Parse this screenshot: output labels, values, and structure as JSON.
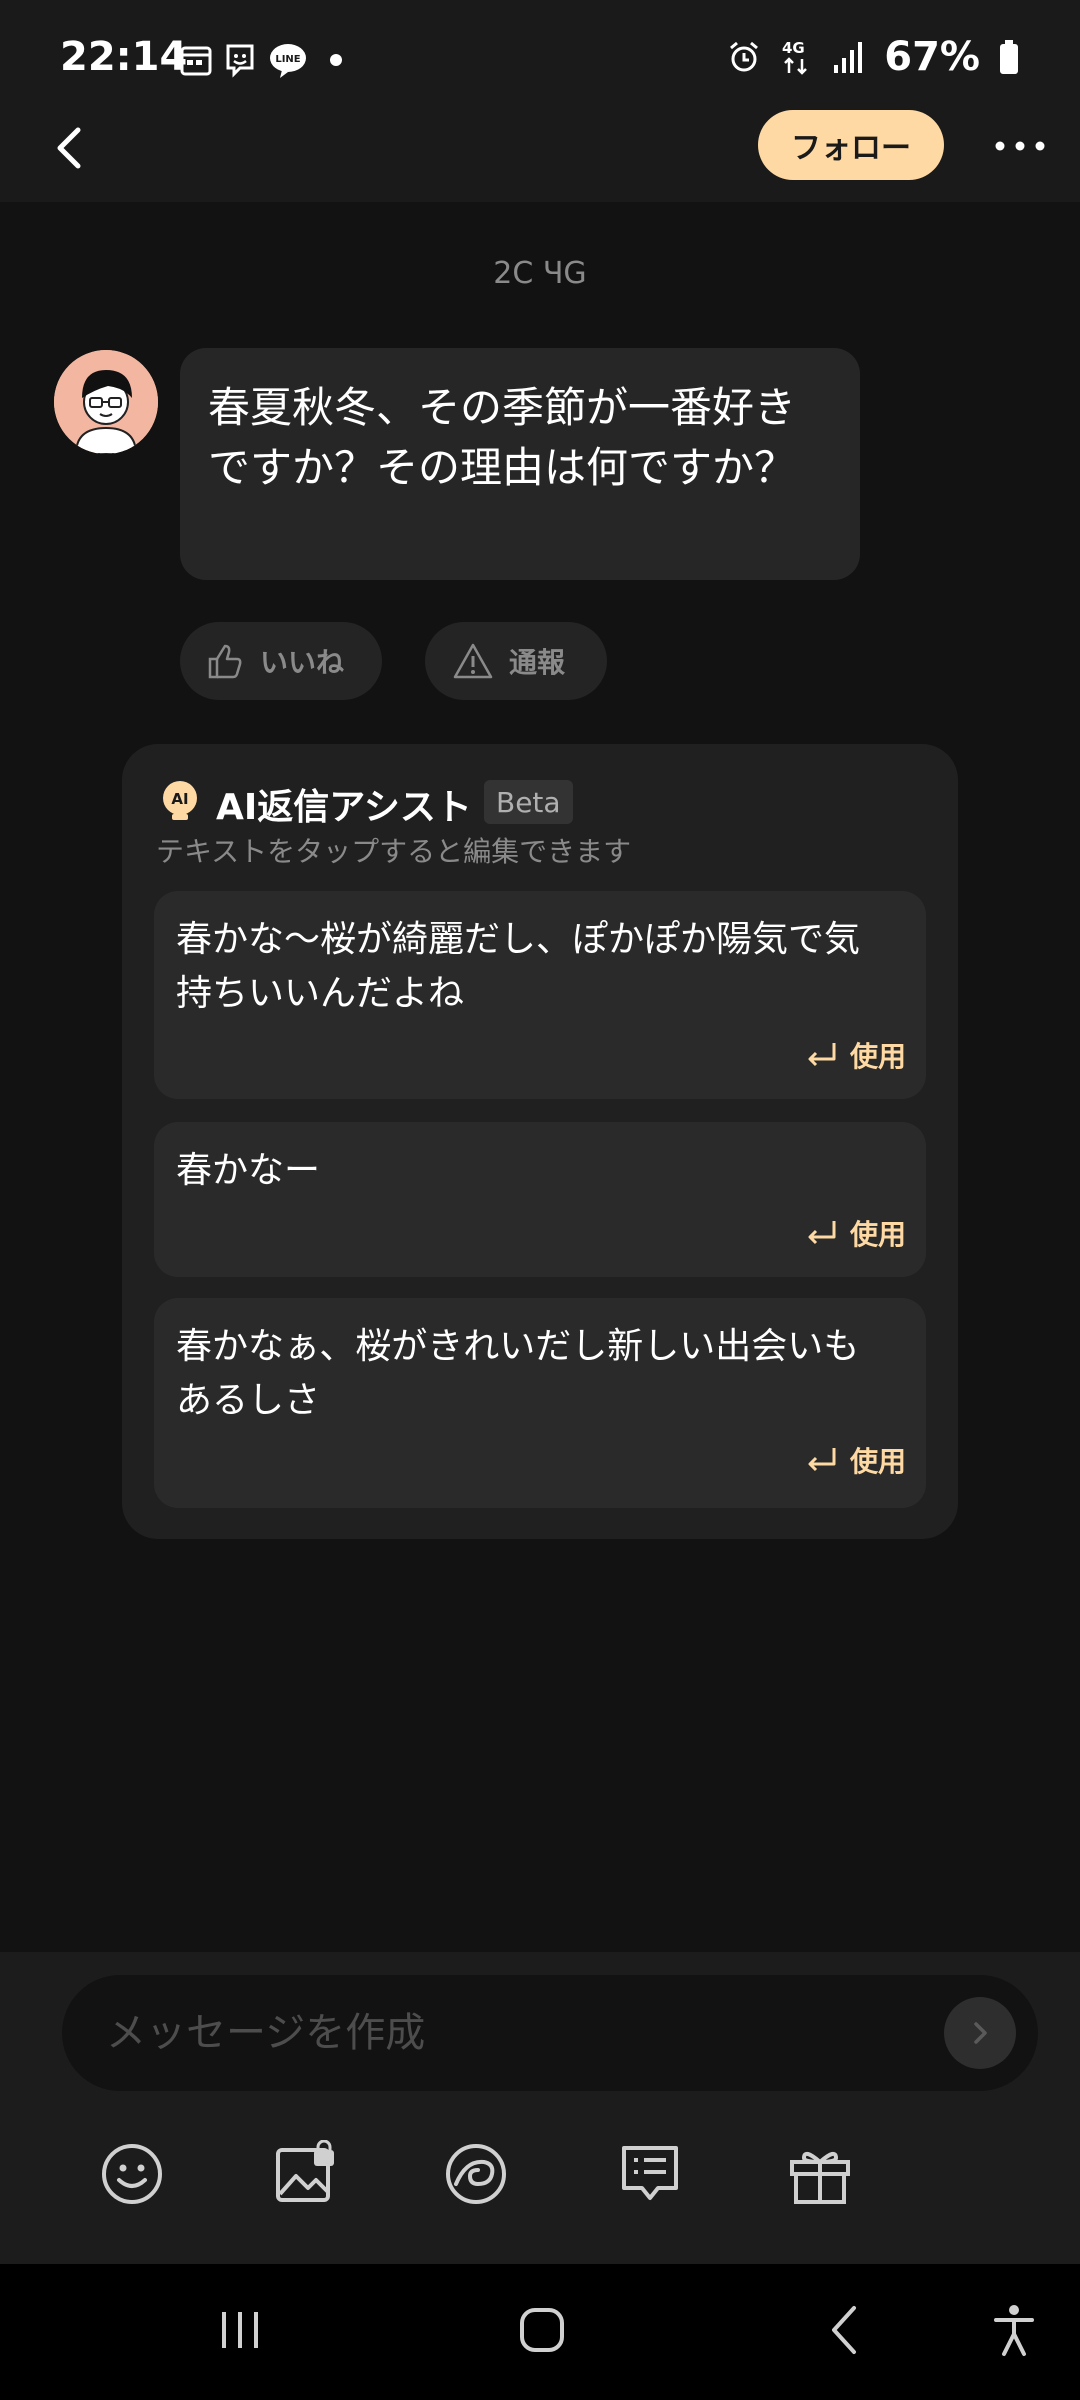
{
  "status_bar": {
    "time": "22:14",
    "battery_percent": "67%",
    "network": "4G",
    "left_icons": [
      "calendar-icon",
      "chat-app-icon",
      "line-app-icon",
      "dot-icon"
    ],
    "right_icons": [
      "alarm-icon",
      "network-4g-icon",
      "signal-icon",
      "battery-icon"
    ]
  },
  "header": {
    "follow_label": "フォロー"
  },
  "chat": {
    "date_label": "2C ЧG",
    "message_text": "春夏秋冬、その季節が一番好きですか？その理由は何ですか？",
    "like_label": "いいね",
    "report_label": "通報"
  },
  "ai_assist": {
    "title": "AI返信アシスト",
    "badge": "Beta",
    "subtitle": "テキストをタップすると編集できます",
    "suggestions": [
      {
        "text": "春かな〜桜が綺麗だし、ぽかぽか陽気で気持ちいいんだよね",
        "use_label": "使用"
      },
      {
        "text": "春かなー",
        "use_label": "使用"
      },
      {
        "text": "春かなぁ、桜がきれいだし新しい出会いもあるしさ",
        "use_label": "使用"
      }
    ]
  },
  "composer": {
    "placeholder": "メッセージを作成",
    "tools": [
      "emoji-icon",
      "locked-image-icon",
      "sticker-icon",
      "message-template-icon",
      "gift-icon"
    ]
  },
  "colors": {
    "background": "#121212",
    "accent": "#ffd9a3",
    "card": "#202020"
  }
}
